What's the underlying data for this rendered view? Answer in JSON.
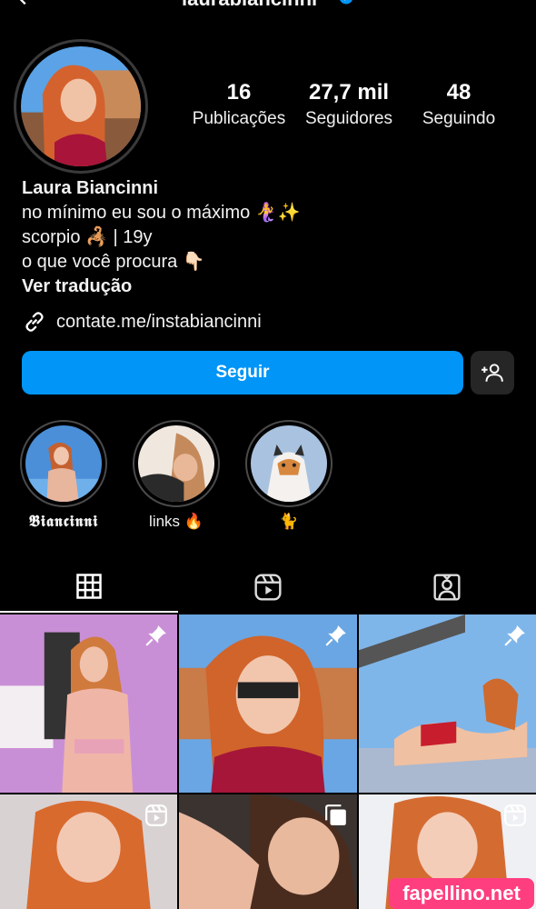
{
  "header": {
    "username": "laurabiancinni",
    "back_icon": "chevron-left-icon",
    "verified_icon": "verified-badge-icon"
  },
  "profile": {
    "stats": [
      {
        "value": "16",
        "label": "Publicações"
      },
      {
        "value": "27,7 mil",
        "label": "Seguidores"
      },
      {
        "value": "48",
        "label": "Seguindo"
      }
    ],
    "name": "Laura Biancinni",
    "bio_lines": [
      "no mínimo eu sou o máximo 🧜‍♀️✨",
      "scorpio 🦂 | 19y",
      "o que você procura 👇🏻"
    ],
    "translate_label": "Ver tradução",
    "link": "contate.me/instabiancinni"
  },
  "actions": {
    "follow_label": "Seguir",
    "add_user_icon": "add-person-icon"
  },
  "highlights": [
    {
      "label": "𝕭𝖎𝖆𝖓𝖈𝖎𝖓𝖓𝖎"
    },
    {
      "label": "links 🔥"
    },
    {
      "label": "🐈"
    }
  ],
  "tabs": [
    {
      "name": "grid",
      "icon": "grid-icon",
      "active": true
    },
    {
      "name": "reels",
      "icon": "reels-icon",
      "active": false
    },
    {
      "name": "tagged",
      "icon": "tagged-person-icon",
      "active": false
    }
  ],
  "posts": [
    {
      "badge": "pin-icon"
    },
    {
      "badge": "pin-icon"
    },
    {
      "badge": "pin-icon"
    },
    {
      "badge": "reels-icon"
    },
    {
      "badge": "carousel-icon"
    },
    {
      "badge": "reels-icon"
    }
  ],
  "watermark": "fapellino.net",
  "colors": {
    "background": "#000000",
    "follow_button": "#0095f6",
    "secondary_button": "#262626",
    "watermark": "#ff3e7f"
  }
}
